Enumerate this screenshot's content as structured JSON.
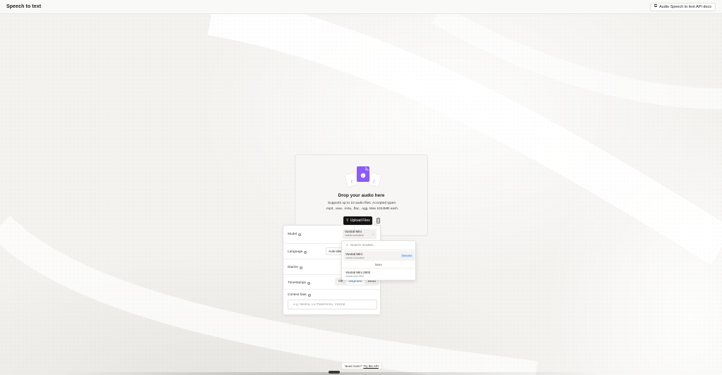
{
  "header": {
    "title": "Speech to text",
    "docs_label": "Audio Speech to text API docs",
    "docs_icon": "external-link-icon"
  },
  "dropzone": {
    "title": "Drop your audio here",
    "subtitle_line1": "Supports up to 10 audio files. Accepted types:",
    "subtitle_line2": ".mp3, .wav, .m4a, .flac, .ogg. Max 1024MB each.",
    "upload_label": "Upload Files",
    "upload_icon": "upload-icon",
    "mic_icon": "microphone-icon",
    "accent": "#8b5cf6"
  },
  "settings": {
    "model": {
      "label": "Model",
      "selected_name": "Voxtral Mini",
      "selected_id": "voxtral-mini-latest"
    },
    "language": {
      "label": "Language",
      "value": "Auto-detect"
    },
    "diarize": {
      "label": "Diarize"
    },
    "timestamps": {
      "label": "Timestamps",
      "options": [
        "Off",
        "Segment",
        "Word"
      ],
      "selected": "Segment"
    },
    "context_bias": {
      "label": "Context bias",
      "placeholder": "e.g. Mistral, La Plateforme, Voxtral"
    }
  },
  "model_dropdown": {
    "search_placeholder": "Search models...",
    "items": [
      {
        "name": "Voxtral Mini",
        "id": "voxtral-mini-latest",
        "badge": "Selected"
      },
      {
        "name": "Voxtral Mini 2602",
        "id": "voxtral-mini-2602"
      }
    ],
    "more_label": "More"
  },
  "footer": {
    "help_text": "Need more?",
    "help_link": "Try the API"
  }
}
